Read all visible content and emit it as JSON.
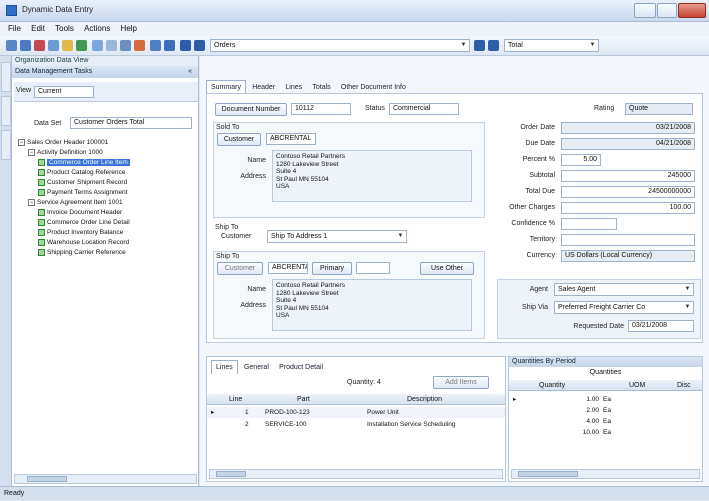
{
  "window": {
    "title": "Dynamic Data Entry"
  },
  "menu": [
    "File",
    "Edit",
    "Tools",
    "Actions",
    "Help"
  ],
  "toolbar": {
    "record_combo": "Orders",
    "second_combo": "Total"
  },
  "left_panel": {
    "header": "Organization Data View",
    "subheader": "Data Management Tasks",
    "view_label": "View",
    "view_value": "Current",
    "filter_label": "Data Set",
    "filter_value": "Customer Orders Total",
    "tree": [
      {
        "text": "Sales Order Header 100001",
        "level": 0,
        "kind": "expand"
      },
      {
        "text": "Activity Definition 1000",
        "level": 1,
        "kind": "expand"
      },
      {
        "text": "Commerce Order Line Item",
        "level": 2,
        "kind": "check",
        "selected": true
      },
      {
        "text": "Product Catalog Reference",
        "level": 2,
        "kind": "check"
      },
      {
        "text": "Customer Shipment Record",
        "level": 2,
        "kind": "check"
      },
      {
        "text": "Payment Terms Assignment",
        "level": 2,
        "kind": "check"
      },
      {
        "text": "Service Agreement Item 1001",
        "level": 1,
        "kind": "expand"
      },
      {
        "text": "Invoice Document Header",
        "level": 2,
        "kind": "check"
      },
      {
        "text": "Commerce Order Line Detail",
        "level": 2,
        "kind": "check"
      },
      {
        "text": "Product Inventory Balance",
        "level": 2,
        "kind": "check"
      },
      {
        "text": "Warehouse Location Record",
        "level": 2,
        "kind": "check"
      },
      {
        "text": "Shipping Carrier Reference",
        "level": 2,
        "kind": "check"
      }
    ]
  },
  "content": {
    "tabs": [
      "Summary",
      "Header",
      "Lines",
      "Totals",
      "Other Document Info"
    ],
    "header_row": {
      "doc_button": "Document Number",
      "doc_value": "10112",
      "status_label": "Status",
      "status_value": "Commercial",
      "right_label": "Rating",
      "right_value": "Quote"
    },
    "bill_to": {
      "section": "Sold To",
      "customer_button": "Customer",
      "customer_value": "ABCRENTAL",
      "name_label": "Name",
      "address_label": "Address",
      "address": "Contoso Retail Partners\n1280 Lakeview Street\nSuite 4\nSt Paul MN 55104\nUSA"
    },
    "ship_to_combo": {
      "label": "Ship To",
      "sublabel": "Customer",
      "value": "Ship To Address 1"
    },
    "ship_to": {
      "section": "Ship To",
      "customer_button": "Customer",
      "customer_value": "ABCRENTAL",
      "primary_button": "Primary",
      "other_button": "Use Other",
      "name_label": "Name",
      "address_label": "Address",
      "address": "Contoso Retail Partners\n1280 Lakeview Street\nSuite 4\nSt Paul MN 55104\nUSA"
    },
    "totals": [
      {
        "label": "Order Date",
        "value": "03/21/2008"
      },
      {
        "label": "Due Date",
        "value": "04/21/2008"
      },
      {
        "label": "Percent %",
        "value": "5.00"
      },
      {
        "label": "Subtotal",
        "value": "245000"
      },
      {
        "label": "Total Due",
        "value": "24500000000"
      },
      {
        "label": "Other Charges",
        "value": "100.00"
      },
      {
        "label": "Confidence %",
        "value": ""
      },
      {
        "label": "Territory",
        "value": ""
      },
      {
        "label": "Currency",
        "value": "US Dollars (Local Currency)"
      }
    ],
    "agent": {
      "label": "Agent",
      "value": "Sales Agent"
    },
    "ship_via": {
      "label": "Ship Via",
      "value": "Preferred Freight Carrier Co"
    },
    "requested": {
      "label": "Requested Date",
      "value": "03/21/2008"
    },
    "lines": {
      "tabs": [
        "Lines",
        "General",
        "Product Detail"
      ],
      "toolbar_text": "Quantity: 4",
      "toolbar_button": "Add Items",
      "headers": [
        "Line",
        "Part",
        "Description"
      ],
      "rows": [
        {
          "line": "1",
          "part": "PROD-100-123",
          "desc": "Power Unit"
        },
        {
          "line": "2",
          "part": "SERVICE-100",
          "desc": "Installation Service Scheduling"
        }
      ]
    },
    "quantities": {
      "header": "Quantities By Period",
      "subheader": "Quantities",
      "headers": [
        "Quantity",
        "UOM",
        "Disc"
      ],
      "rows": [
        {
          "qty": "1.00",
          "uom": "Ea"
        },
        {
          "qty": "2.00",
          "uom": "Ea"
        },
        {
          "qty": "4.00",
          "uom": "Ea"
        },
        {
          "qty": "10.00",
          "uom": "Ea"
        }
      ]
    }
  },
  "status": "Ready"
}
